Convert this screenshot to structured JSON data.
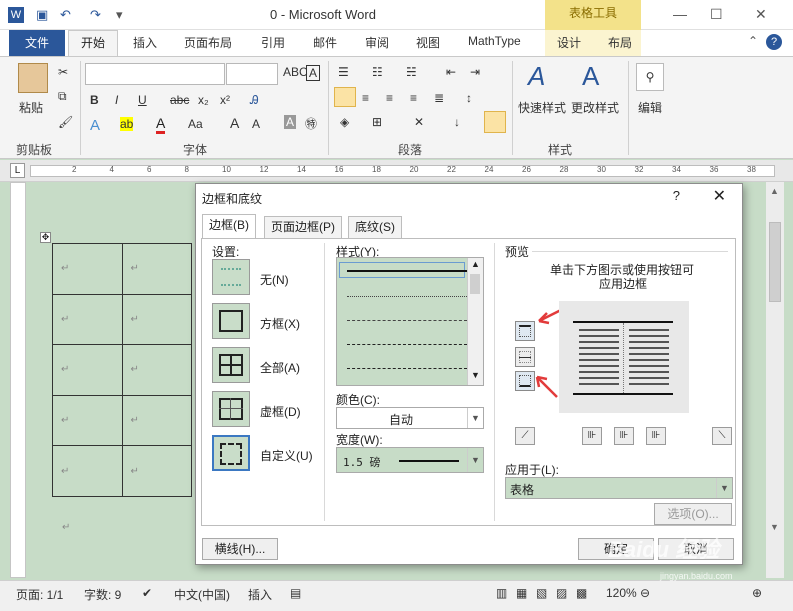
{
  "app": {
    "title": "0 - Microsoft Word",
    "context_tab_group": "表格工具",
    "accent": "#2b579a"
  },
  "tabs": [
    "文件",
    "开始",
    "插入",
    "页面布局",
    "引用",
    "邮件",
    "审阅",
    "视图",
    "MathType",
    "设计",
    "布局"
  ],
  "ribbon": {
    "paste_label": "粘贴",
    "groups": [
      "剪贴板",
      "字体",
      "段落",
      "样式",
      "编辑"
    ],
    "quick_style_label": "快速样式",
    "change_style_label": "更改样式",
    "edit_label": "编辑"
  },
  "ruler_ticks": [
    "2",
    "4",
    "6",
    "8",
    "10",
    "12",
    "14",
    "16",
    "18",
    "20",
    "22",
    "24",
    "26",
    "28",
    "30",
    "32",
    "34",
    "36",
    "38"
  ],
  "dialog": {
    "title": "边框和底纹",
    "help": "?",
    "tabs": [
      "边框(B)",
      "页面边框(P)",
      "底纹(S)"
    ],
    "settings_label": "设置:",
    "settings": [
      "无(N)",
      "方框(X)",
      "全部(A)",
      "虚框(D)",
      "自定义(U)"
    ],
    "style_label": "样式(Y):",
    "color_label": "颜色(C):",
    "color_value": "自动",
    "width_label": "宽度(W):",
    "width_value": "1.5 磅",
    "preview_label": "预览",
    "preview_hint_line1": "单击下方图示或使用按钮可",
    "preview_hint_line2": "应用边框",
    "apply_to_label": "应用于(L):",
    "apply_to_value": "表格",
    "options_button": "选项(O)...",
    "horizontal_line_button": "横线(H)...",
    "ok_button": "确定",
    "cancel_button": "取消"
  },
  "status": {
    "page": "页面: 1/1",
    "words": "字数: 9",
    "language": "中文(中国)",
    "insert_mode": "插入",
    "zoom": "120%"
  },
  "watermark": "Baidu 经验",
  "watermark_url": "jingyan.baidu.com"
}
